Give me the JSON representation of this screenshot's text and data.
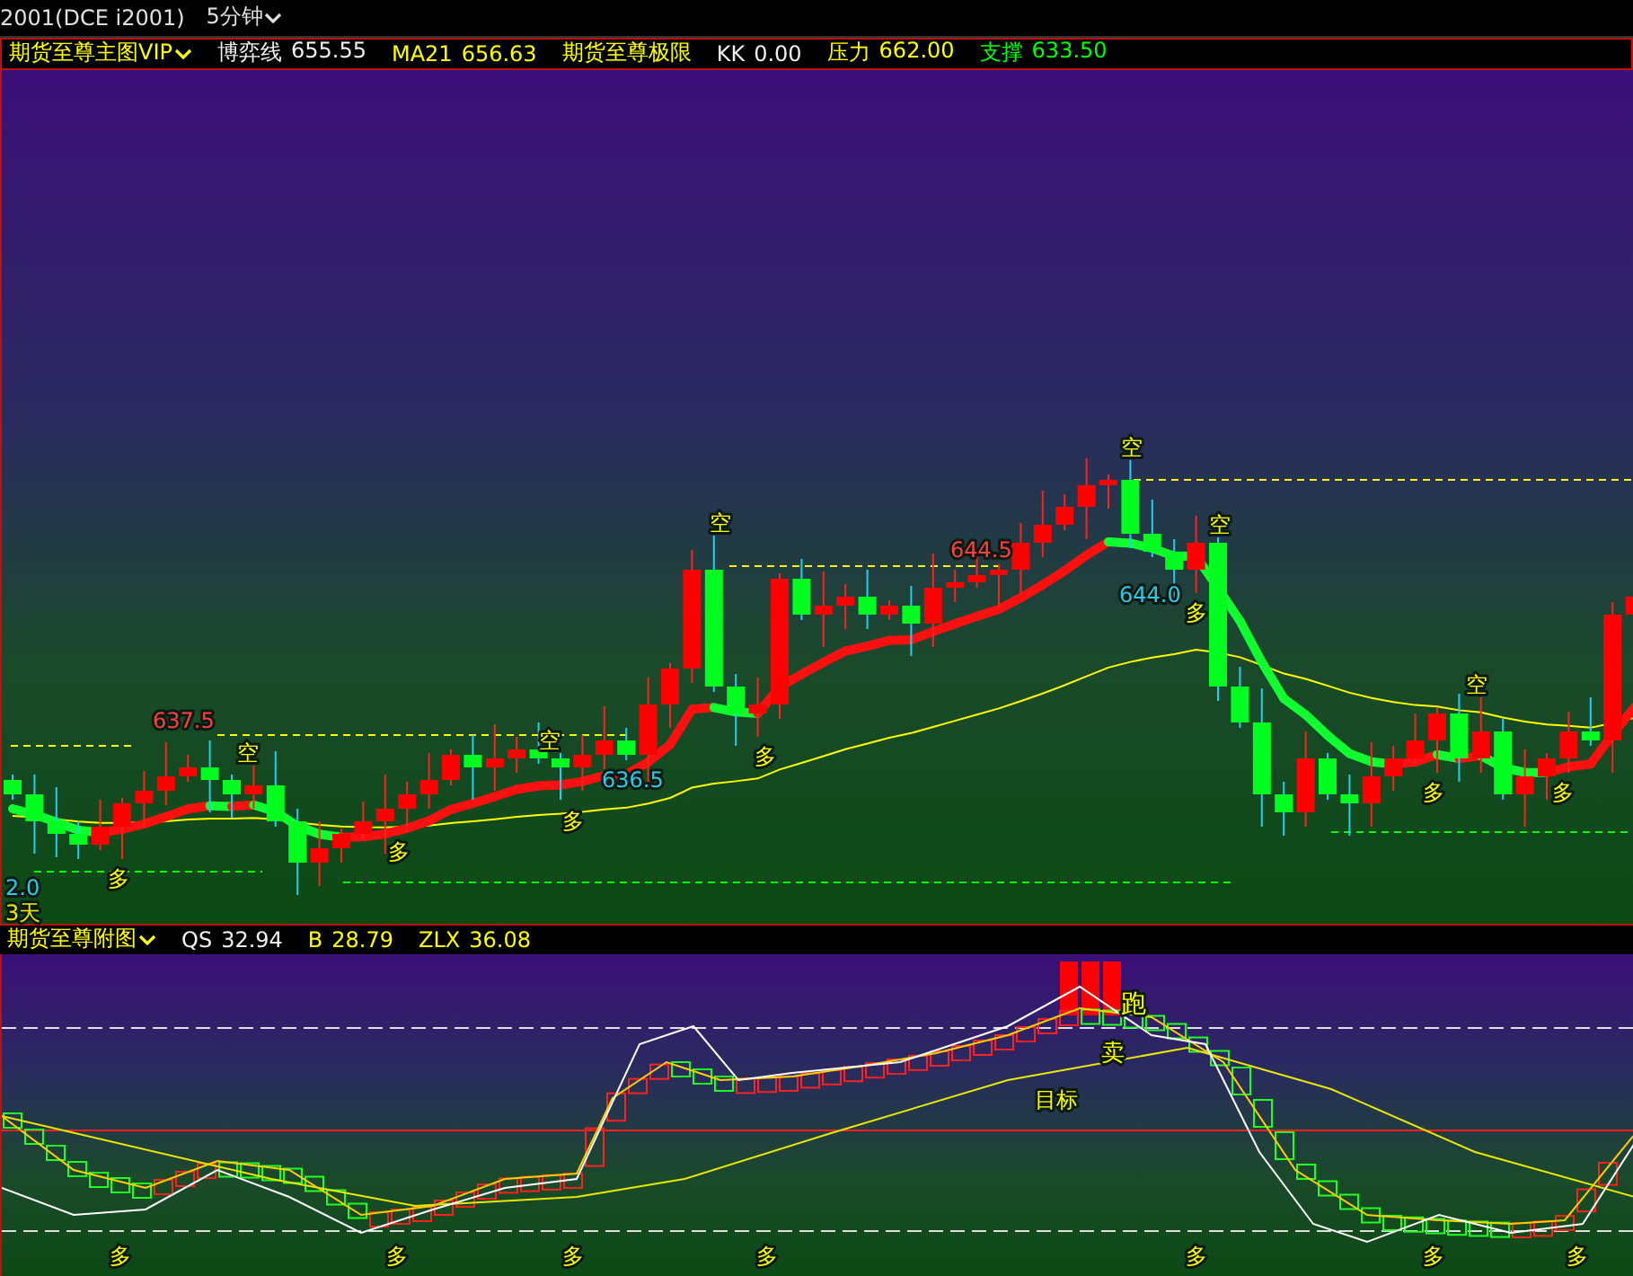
{
  "title_bar": {
    "symbol": "2001(DCE i2001)",
    "period": "5分钟"
  },
  "main_header": {
    "menu": "期货至尊主图VIP",
    "indicators": [
      {
        "label": "博弈线",
        "value": "655.55",
        "kind": "line"
      },
      {
        "label": "MA21",
        "value": "656.63",
        "kind": "average"
      },
      {
        "label": "期货至尊极限",
        "kind": "group"
      },
      {
        "label": "KK",
        "value": "0.00",
        "kind": "line"
      },
      {
        "label": "压力",
        "value": "662.00",
        "kind": "resistance"
      },
      {
        "label": "支撑",
        "value": "633.50",
        "kind": "support"
      }
    ]
  },
  "main_chart": {
    "price_labels": [
      {
        "text": "637.5",
        "kind": "high"
      },
      {
        "text": "636.5",
        "kind": "low"
      },
      {
        "text": "644.5",
        "kind": "high"
      },
      {
        "text": "644.0",
        "kind": "low"
      }
    ],
    "sell_marks": [
      {
        "text": "空"
      },
      {
        "text": "空"
      },
      {
        "text": "空"
      },
      {
        "text": "空"
      },
      {
        "text": "空"
      },
      {
        "text": "空"
      }
    ],
    "buy_marks": [
      {
        "text": "多"
      },
      {
        "text": "多"
      },
      {
        "text": "多"
      },
      {
        "text": "多"
      },
      {
        "text": "多"
      },
      {
        "text": "多"
      },
      {
        "text": "多"
      }
    ],
    "axis_value": "2.0",
    "days": "3天"
  },
  "sub_header": {
    "menu": "期货至尊附图",
    "indicators": [
      {
        "label": "QS",
        "value": "32.94",
        "kind": "line"
      },
      {
        "label": "B",
        "value": "28.79",
        "kind": "average"
      },
      {
        "label": "ZLX",
        "value": "36.08",
        "kind": "average"
      }
    ]
  },
  "sub_chart": {
    "signals": [
      {
        "text": "跑"
      },
      {
        "text": "卖"
      },
      {
        "text": "目标"
      }
    ],
    "buy_marks": [
      {
        "text": "多"
      },
      {
        "text": "多"
      },
      {
        "text": "多"
      },
      {
        "text": "多"
      },
      {
        "text": "多"
      },
      {
        "text": "多"
      },
      {
        "text": "多"
      }
    ]
  }
}
